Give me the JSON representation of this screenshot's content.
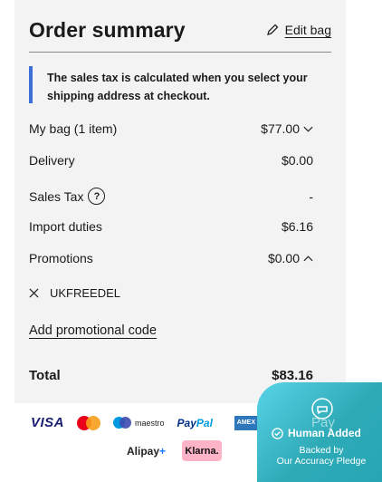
{
  "summary": {
    "title": "Order summary",
    "edit_label": "Edit bag",
    "notice": [
      "The sales tax is calculated when you select your",
      "shipping address at checkout."
    ]
  },
  "rows": {
    "bag": {
      "label": "My bag (1 item)",
      "value": "$77.00"
    },
    "delivery": {
      "label": "Delivery",
      "value": "$0.00"
    },
    "tax": {
      "label": "Sales Tax",
      "value": "-",
      "help": "?"
    },
    "duties": {
      "label": "Import duties",
      "value": "$6.16"
    },
    "promotions": {
      "label": "Promotions",
      "value": "$0.00"
    }
  },
  "promo": {
    "code": "UKFREEDEL",
    "add_label": "Add promotional code"
  },
  "total": {
    "label": "Total",
    "value": "$83.16"
  },
  "payments": {
    "visa": "VISA",
    "maestro": "maestro",
    "paypal_a": "Pay",
    "paypal_b": "Pal",
    "amex": "AMEX",
    "alipay": "Alipay",
    "klarna": "Klarna."
  },
  "badge": {
    "pay_text": "Pay",
    "title": "Human Added",
    "sub1": "Backed by",
    "sub2": "Our Accuracy Pledge"
  },
  "colors": {
    "panel_bg": "#f3f3f3",
    "notice_accent": "#3d6fd8",
    "badge_start": "#59d3e8",
    "badge_end": "#27a6b4"
  },
  "icons": [
    "pencil-icon",
    "chevron-down-icon",
    "chevron-up-icon",
    "question-icon",
    "close-icon",
    "chat-bubble-icon",
    "check-circle-icon"
  ]
}
